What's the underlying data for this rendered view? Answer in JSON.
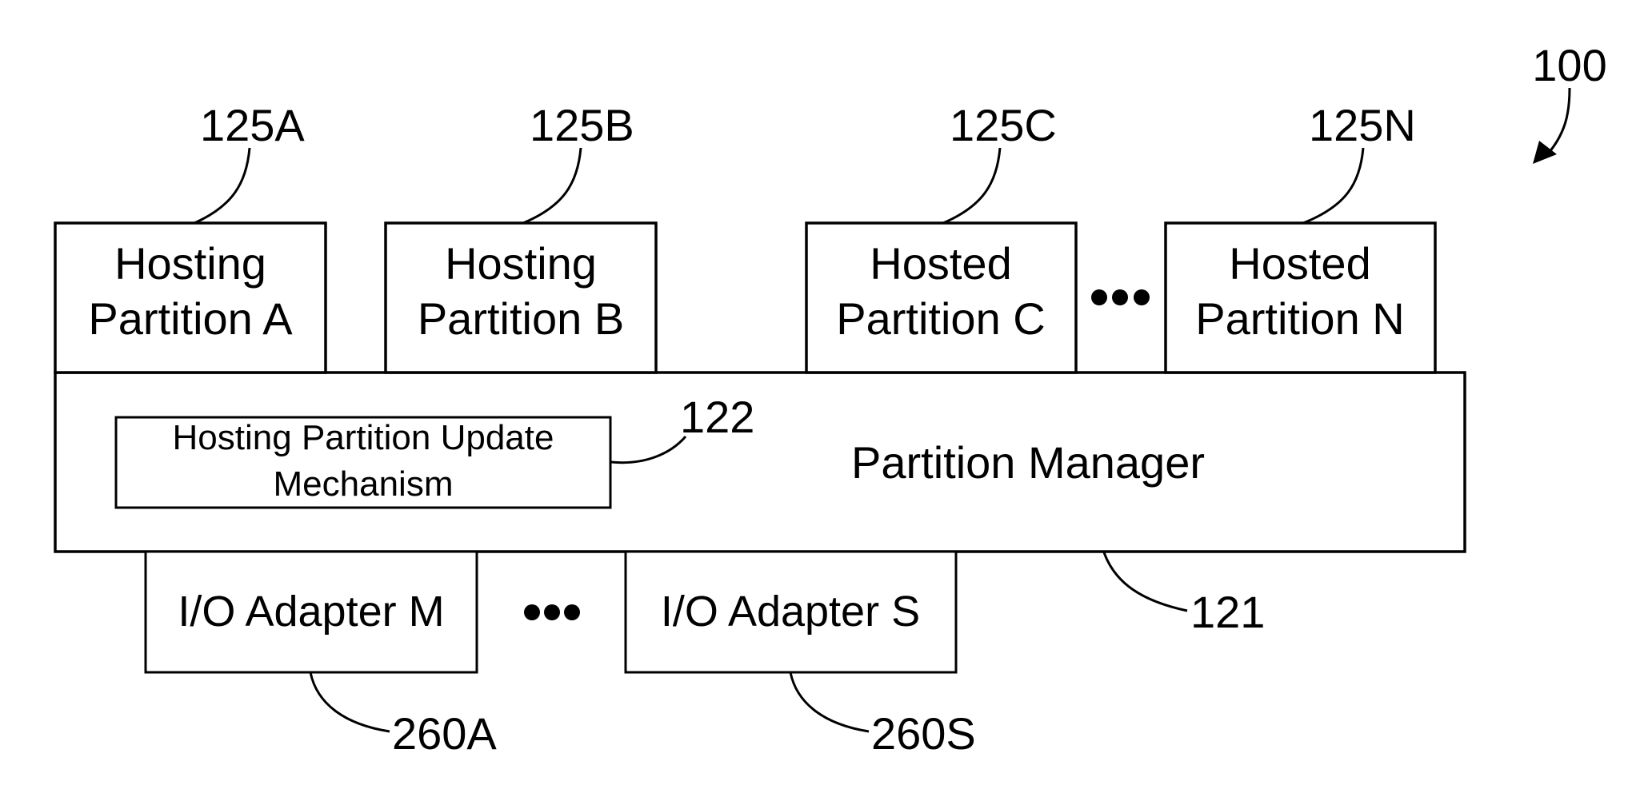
{
  "figure": {
    "reference": "100"
  },
  "partitions": [
    {
      "ref": "125A",
      "line1": "Hosting",
      "line2": "Partition A"
    },
    {
      "ref": "125B",
      "line1": "Hosting",
      "line2": "Partition B"
    },
    {
      "ref": "125C",
      "line1": "Hosted",
      "line2": "Partition C"
    },
    {
      "ref": "125N",
      "line1": "Hosted",
      "line2": "Partition N"
    }
  ],
  "partition_ellipsis": "•••",
  "partition_manager": {
    "label": "Partition Manager",
    "ref": "121",
    "update_mechanism": {
      "line1": "Hosting Partition Update",
      "line2": "Mechanism",
      "ref": "122"
    }
  },
  "io_adapters": [
    {
      "label": "I/O Adapter M",
      "ref": "260A"
    },
    {
      "label": "I/O Adapter S",
      "ref": "260S"
    }
  ],
  "io_ellipsis": "•••"
}
